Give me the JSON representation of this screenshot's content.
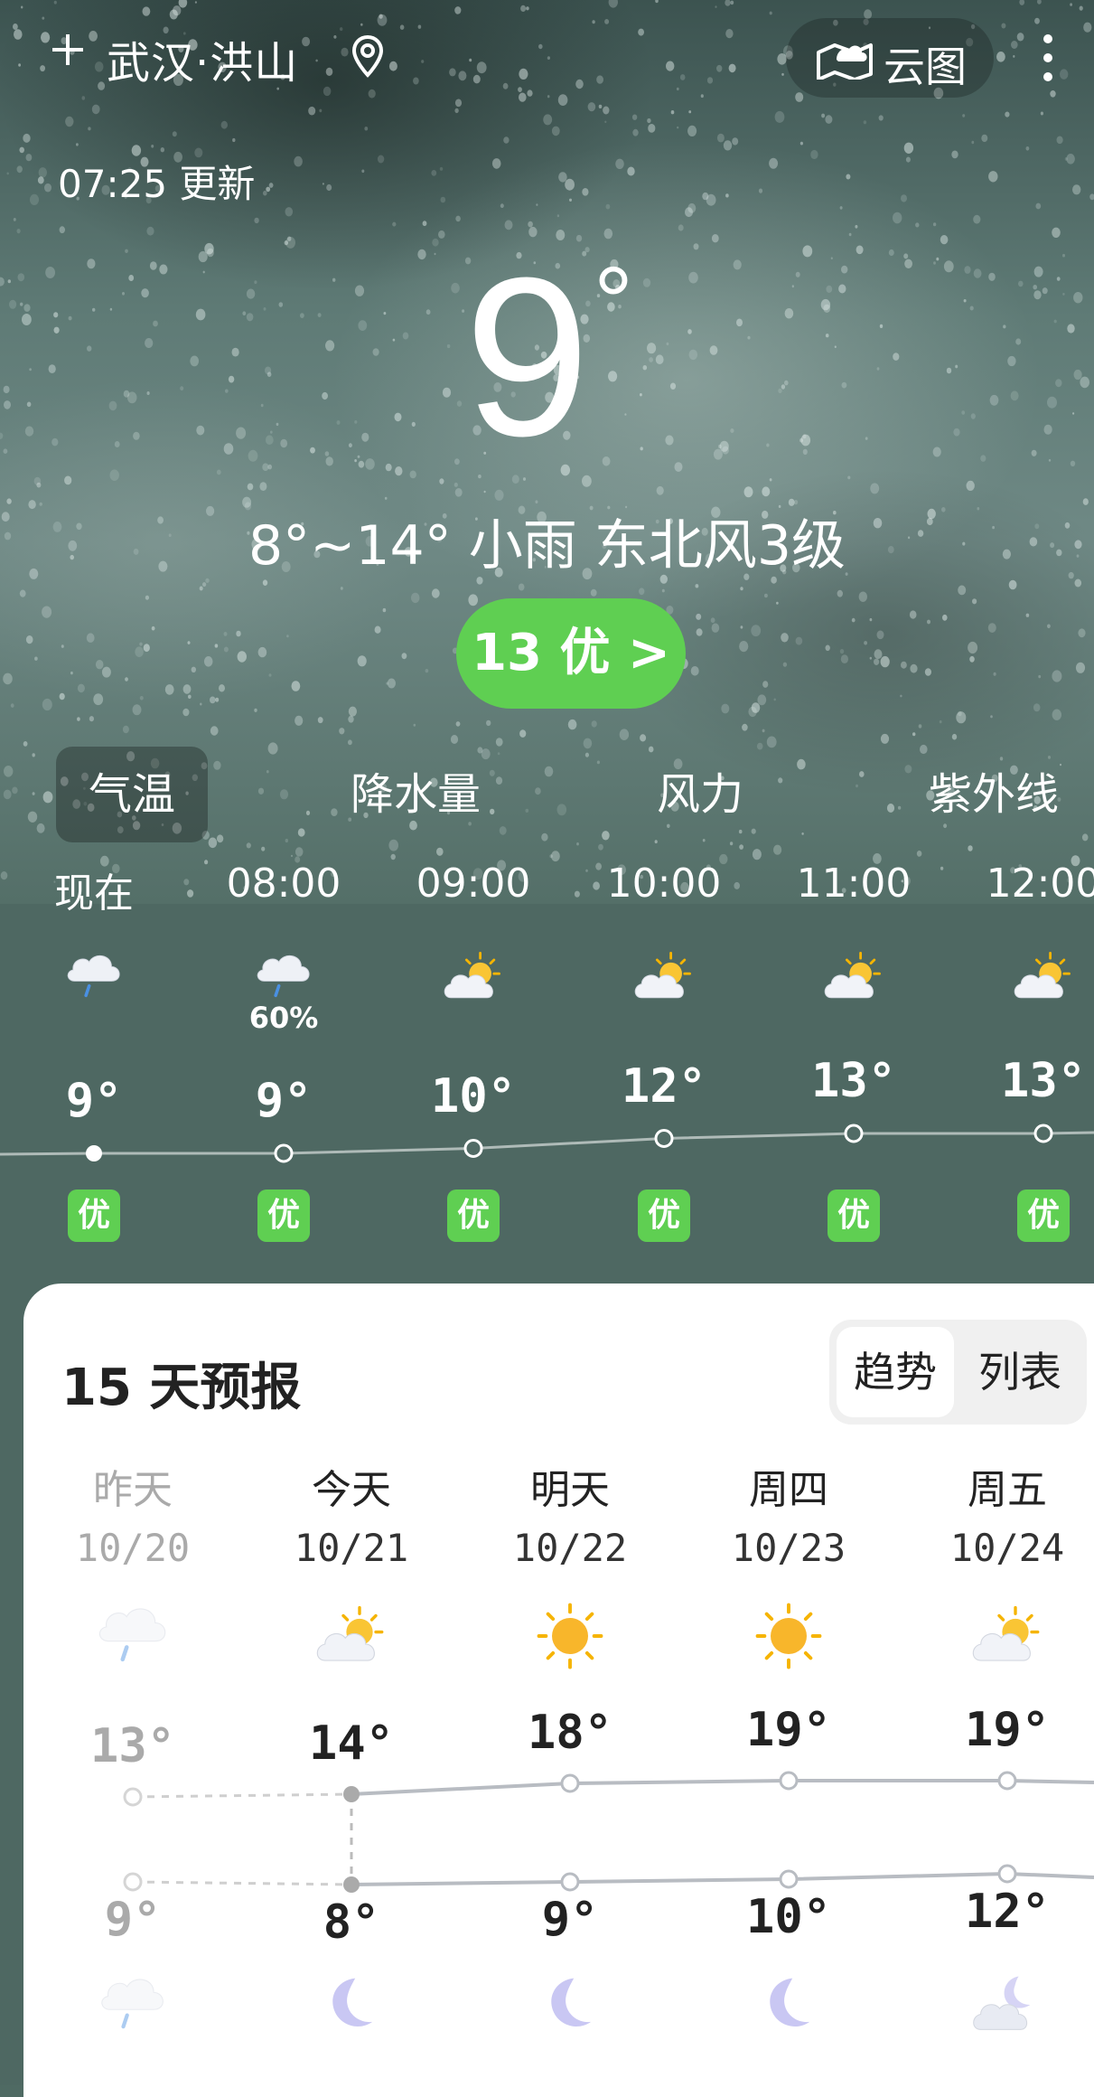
{
  "location": {
    "city": "武汉·洪山"
  },
  "header": {
    "cloud_map_label": "云图"
  },
  "update_time": "07:25 更新",
  "current": {
    "temp": "9",
    "degree": "°",
    "summary": "8°~14° 小雨 东北风3级",
    "aqi_label": "13 优 >"
  },
  "tabs": [
    "气温",
    "降水量",
    "风力",
    "紫外线"
  ],
  "hourly": [
    {
      "time": "现在",
      "icon": "rain-cloud-icon",
      "pop": "",
      "temp": "9°",
      "aqi": "优",
      "value": 9
    },
    {
      "time": "08:00",
      "icon": "rain-cloud-icon",
      "pop": "60%",
      "temp": "9°",
      "aqi": "优",
      "value": 9
    },
    {
      "time": "09:00",
      "icon": "partly-cloudy-icon",
      "pop": "",
      "temp": "10°",
      "aqi": "优",
      "value": 10
    },
    {
      "time": "10:00",
      "icon": "partly-cloudy-icon",
      "pop": "",
      "temp": "12°",
      "aqi": "优",
      "value": 12
    },
    {
      "time": "11:00",
      "icon": "partly-cloudy-icon",
      "pop": "",
      "temp": "13°",
      "aqi": "优",
      "value": 13
    },
    {
      "time": "12:00",
      "icon": "partly-cloudy-icon",
      "pop": "",
      "temp": "13°",
      "aqi": "优",
      "value": 13
    }
  ],
  "forecast": {
    "title": "15 天预报",
    "view_options": [
      "趋势",
      "列表"
    ],
    "days": [
      {
        "label": "昨天",
        "date": "10/20",
        "day_icon": "rain-cloud-icon",
        "high": "13°",
        "low": "9°",
        "night_icon": "rain-cloud-icon",
        "high_value": 13,
        "low_value": 9
      },
      {
        "label": "今天",
        "date": "10/21",
        "day_icon": "partly-sunny-icon",
        "high": "14°",
        "low": "8°",
        "night_icon": "moon-icon",
        "high_value": 14,
        "low_value": 8
      },
      {
        "label": "明天",
        "date": "10/22",
        "day_icon": "sun-icon",
        "high": "18°",
        "low": "9°",
        "night_icon": "moon-icon",
        "high_value": 18,
        "low_value": 9
      },
      {
        "label": "周四",
        "date": "10/23",
        "day_icon": "sun-icon",
        "high": "19°",
        "low": "10°",
        "night_icon": "moon-icon",
        "high_value": 19,
        "low_value": 10
      },
      {
        "label": "周五",
        "date": "10/24",
        "day_icon": "partly-sunny-icon",
        "high": "19°",
        "low": "12°",
        "night_icon": "moon-cloud-icon",
        "high_value": 19,
        "low_value": 12
      }
    ]
  },
  "colors": {
    "aqi_good": "#5fcf52",
    "card_bg": "#ffffff"
  }
}
